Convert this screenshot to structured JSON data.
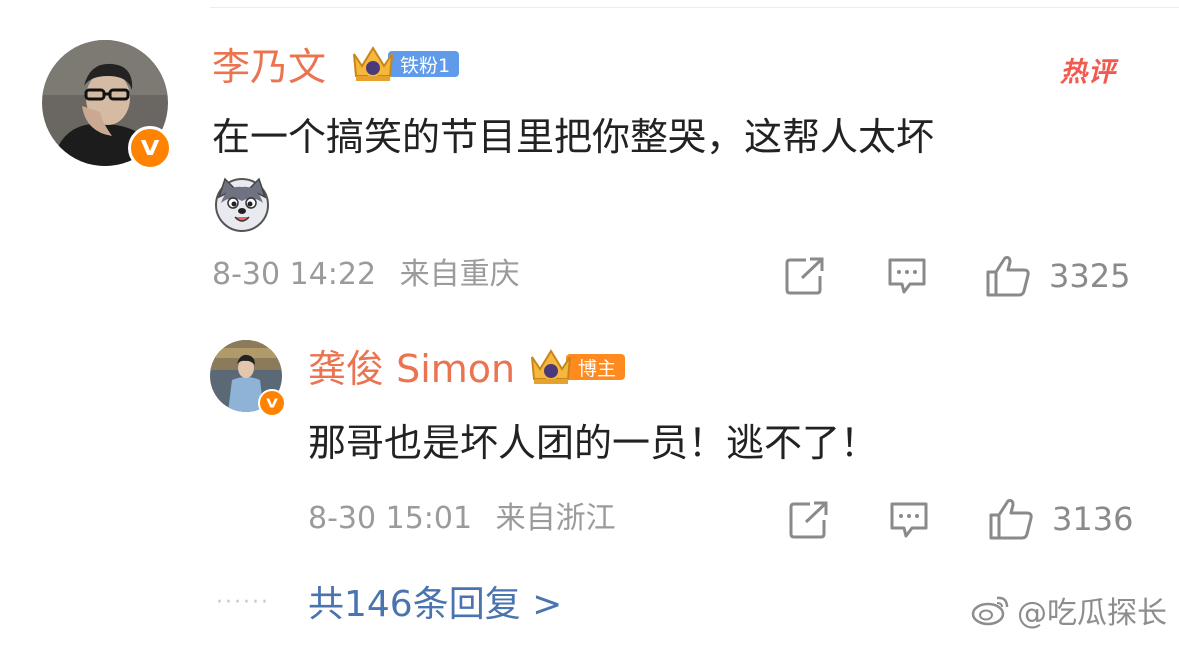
{
  "comment": {
    "username": "李乃文",
    "fan_badge": "铁粉1",
    "hot_label": "热评",
    "text": "在一个搞笑的节目里把你整哭，这帮人太坏",
    "emoji_icon": "husky-dog-emoji",
    "timestamp": "8-30 14:22",
    "location": "来自重庆",
    "like_count": "3325"
  },
  "reply": {
    "username": "龚俊 Simon",
    "badge": "博主",
    "text": "那哥也是坏人团的一员！逃不了！",
    "timestamp": "8-30 15:01",
    "location": "来自浙江",
    "like_count": "3136"
  },
  "more_replies": "共146条回复 >",
  "watermark": "@吃瓜探长",
  "colors": {
    "username": "#eb7350",
    "fan_badge_bg": "#5f9bea",
    "author_badge_bg": "#ff8a1f",
    "verified_badge": "#ff8200",
    "hot_label": "#f15a4f",
    "link": "#4a74b0",
    "meta": "#9b9b9b"
  }
}
